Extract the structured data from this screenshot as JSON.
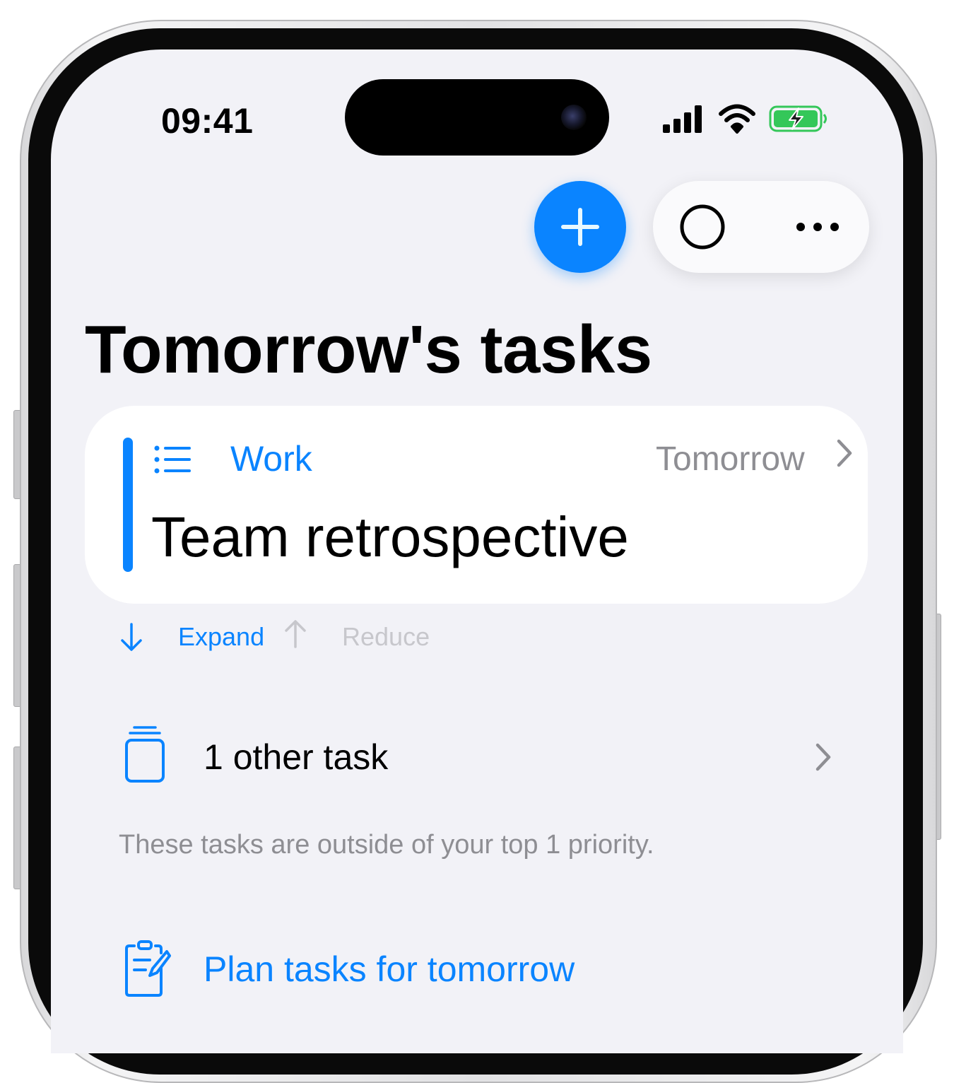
{
  "status_bar": {
    "time": "09:41",
    "icons": [
      "cellular-signal-icon",
      "wifi-icon",
      "battery-charging-icon"
    ],
    "battery_color": "#34c759"
  },
  "toolbar": {
    "add_icon": "plus-icon",
    "circle_icon": "circle-icon",
    "more_icon": "ellipsis-icon"
  },
  "page": {
    "title": "Tomorrow's tasks"
  },
  "task_card": {
    "category_icon": "list-icon",
    "category": "Work",
    "date": "Tomorrow",
    "title": "Team retrospective",
    "accent_color": "#0a84ff"
  },
  "controls": {
    "expand_label": "Expand",
    "reduce_label": "Reduce"
  },
  "other_tasks": {
    "icon": "stack-icon",
    "label": "1 other task",
    "note": "These tasks are outside of your top 1 priority."
  },
  "plan": {
    "icon": "clipboard-edit-icon",
    "label": "Plan tasks for tomorrow"
  },
  "colors": {
    "accent": "#0a84ff",
    "background": "#f2f2f7",
    "secondary_text": "#8e8e93",
    "disabled_text": "#c7c7cc"
  }
}
